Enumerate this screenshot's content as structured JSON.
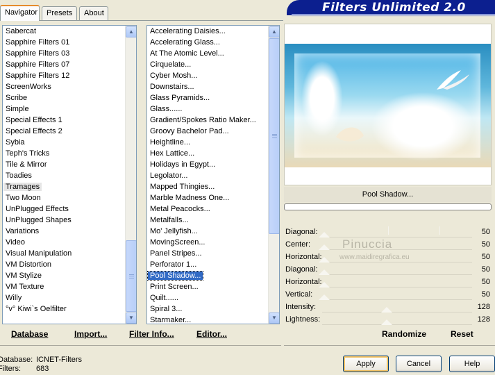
{
  "tabs": [
    {
      "label": "Navigator",
      "active": true
    },
    {
      "label": "Presets",
      "active": false
    },
    {
      "label": "About",
      "active": false
    }
  ],
  "window_title": "Filters Unlimited 2.0",
  "categories": [
    "Sabercat",
    "Sapphire Filters 01",
    "Sapphire Filters 03",
    "Sapphire Filters 07",
    "Sapphire Filters 12",
    "ScreenWorks",
    "Scribe",
    "Simple",
    "Special Effects 1",
    "Special Effects 2",
    "Sybia",
    "Teph's Tricks",
    "Tile & Mirror",
    "Toadies",
    "Tramages",
    "Two Moon",
    "UnPlugged Effects",
    "UnPlugged Shapes",
    "Variations",
    "Video",
    "Visual Manipulation",
    "VM Distortion",
    "VM Stylize",
    "VM Texture",
    "Willy",
    "°v° Kiwi`s Oelfilter"
  ],
  "selected_category": "Tramages",
  "filters": [
    "Accelerating Daisies...",
    "Accelerating Glass...",
    "At The Atomic Level...",
    "Cirquelate...",
    "Cyber Mosh...",
    "Downstairs...",
    "Glass Pyramids...",
    "Glass......",
    "Gradient/Spokes Ratio Maker...",
    "Groovy Bachelor Pad...",
    "Heightline...",
    "Hex Lattice...",
    "Holidays in Egypt...",
    "Legolator...",
    "Mapped Thingies...",
    "Marble Madness One...",
    "Metal Peacocks...",
    "Metalfalls...",
    "Mo' Jellyfish...",
    "MovingScreen...",
    "Panel Stripes...",
    "Perforator 1...",
    "Pool Shadow...",
    "Print Screen...",
    "Quilt......",
    "Spiral 3...",
    "Starmaker..."
  ],
  "selected_filter": "Pool Shadow...",
  "bottom_links": {
    "database": "Database",
    "import": "Import...",
    "filter_info": "Filter Info...",
    "editor": "Editor..."
  },
  "current_filter_label": "Pool Shadow...",
  "params": [
    {
      "label": "Diagonal:",
      "value": "50"
    },
    {
      "label": "Center:",
      "value": "50"
    },
    {
      "label": "Horizontal:",
      "value": "50"
    },
    {
      "label": "Diagonal:",
      "value": "50"
    },
    {
      "label": "Horizontal:",
      "value": "50"
    },
    {
      "label": "Vertical:",
      "value": "50"
    },
    {
      "label": "Intensity:",
      "value": "128"
    },
    {
      "label": "Lightness:",
      "value": "128"
    }
  ],
  "watermark": {
    "name": "Pinuccia",
    "url": "www.maidiregrafica.eu"
  },
  "right_links": {
    "randomize": "Randomize",
    "reset": "Reset"
  },
  "info": {
    "database_label": "Database:",
    "database_value": "ICNET-Filters",
    "filters_label": "Filters:",
    "filters_value": "683"
  },
  "buttons": {
    "apply": "Apply",
    "cancel": "Cancel",
    "help": "Help"
  },
  "colors": {
    "selection": "#316ac5",
    "banner": "#0c1f8f",
    "accent_tab": "#e68b2c"
  }
}
